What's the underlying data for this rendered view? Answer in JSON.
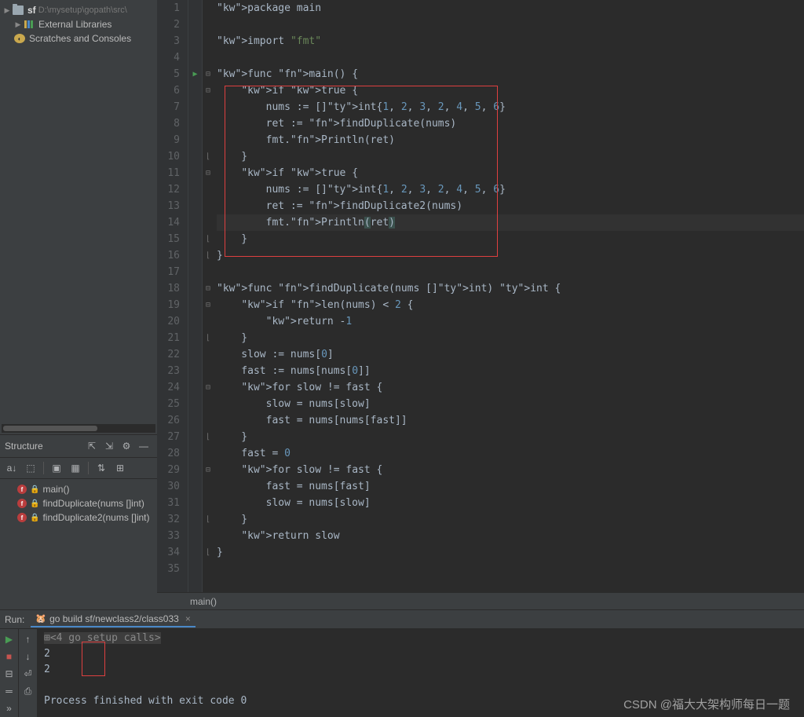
{
  "projectTree": {
    "root": {
      "name": "sf",
      "path": "D:\\mysetup\\gopath\\src\\"
    },
    "items": [
      {
        "label": "External Libraries"
      },
      {
        "label": "Scratches and Consoles"
      }
    ]
  },
  "structure": {
    "title": "Structure",
    "items": [
      {
        "name": "main()"
      },
      {
        "name": "findDuplicate(nums []int)"
      },
      {
        "name": "findDuplicate2(nums []int)"
      }
    ]
  },
  "editor": {
    "lines": [
      "package main",
      "",
      "import \"fmt\"",
      "",
      "func main() {",
      "    if true {",
      "        nums := []int{1, 2, 3, 2, 4, 5, 6}",
      "        ret := findDuplicate(nums)",
      "        fmt.Println(ret)",
      "    }",
      "    if true {",
      "        nums := []int{1, 2, 3, 2, 4, 5, 6}",
      "        ret := findDuplicate2(nums)",
      "        fmt.Println(ret)",
      "    }",
      "}",
      "",
      "func findDuplicate(nums []int) int {",
      "    if len(nums) < 2 {",
      "        return -1",
      "    }",
      "    slow := nums[0]",
      "    fast := nums[nums[0]]",
      "    for slow != fast {",
      "        slow = nums[slow]",
      "        fast = nums[nums[fast]]",
      "    }",
      "    fast = 0",
      "    for slow != fast {",
      "        fast = nums[fast]",
      "        slow = nums[slow]",
      "    }",
      "    return slow",
      "}",
      ""
    ],
    "breadcrumb": "main()"
  },
  "run": {
    "label": "Run:",
    "tabTitle": "go build sf/newclass2/class033",
    "console": [
      "<4 go setup calls>",
      "2",
      "2",
      "",
      "Process finished with exit code 0"
    ]
  },
  "watermark": "CSDN @福大大架构师每日一题"
}
